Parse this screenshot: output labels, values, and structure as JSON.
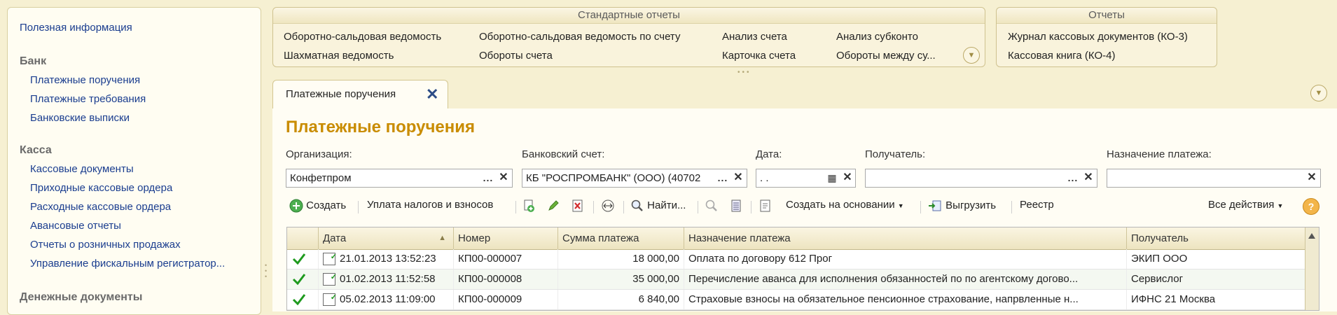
{
  "sidebar": {
    "useful_info": "Полезная информация",
    "groups": [
      {
        "title": "Банк",
        "items": [
          "Платежные поручения",
          "Платежные требования",
          "Банковские выписки"
        ]
      },
      {
        "title": "Касса",
        "items": [
          "Кассовые документы",
          "Приходные кассовые ордера",
          "Расходные кассовые ордера",
          "Авансовые отчеты",
          "Отчеты о розничных продажах",
          "Управление фискальным регистратор..."
        ]
      },
      {
        "title": "Денежные документы",
        "items": []
      }
    ]
  },
  "standard_reports": {
    "title": "Стандартные отчеты",
    "links": [
      "Оборотно-сальдовая ведомость",
      "Оборотно-сальдовая ведомость по счету",
      "Анализ счета",
      "Анализ субконто",
      "Шахматная ведомость",
      "Обороты счета",
      "Карточка счета",
      "Обороты между су..."
    ]
  },
  "reports": {
    "title": "Отчеты",
    "links": [
      "Журнал кассовых документов (КО-3)",
      "Кассовая книга (КО-4)"
    ]
  },
  "tab": {
    "label": "Платежные поручения"
  },
  "page_title": "Платежные поручения",
  "filters": {
    "organization": {
      "label": "Организация:",
      "value": "Конфетпром"
    },
    "bank_account": {
      "label": "Банковский счет:",
      "value": "КБ \"РОСПРОМБАНК\" (ООО) (40702"
    },
    "date": {
      "label": "Дата:",
      "value": " .  ."
    },
    "recipient": {
      "label": "Получатель:",
      "value": ""
    },
    "purpose": {
      "label": "Назначение платежа:",
      "value": ""
    }
  },
  "toolbar": {
    "create": "Создать",
    "taxes": "Уплата налогов и взносов",
    "find": "Найти...",
    "create_based": "Создать на основании",
    "upload": "Выгрузить",
    "registry": "Реестр",
    "all_actions": "Все действия",
    "help": "?"
  },
  "table": {
    "columns": [
      "Дата",
      "Номер",
      "Сумма платежа",
      "Назначение платежа",
      "Получатель"
    ],
    "rows": [
      {
        "date": "21.01.2013 13:52:23",
        "number": "КП00-000007",
        "sum": "18 000,00",
        "purpose": "Оплата по договору 612 Прог",
        "recipient": "ЭКИП ООО"
      },
      {
        "date": "01.02.2013 11:52:58",
        "number": "КП00-000008",
        "sum": "35 000,00",
        "purpose": "Перечисление аванса для исполнения обязанностей по по агентскому догово...",
        "recipient": "Сервислог"
      },
      {
        "date": "05.02.2013 11:09:00",
        "number": "КП00-000009",
        "sum": "6 840,00",
        "purpose": "Страховые взносы на обязательное пенсионное страхование, напрвленные н...",
        "recipient": "ИФНС 21 Москва"
      }
    ]
  },
  "colors": {
    "accent": "#c98c00",
    "link": "#1a3d8f",
    "check": "#1e9a1e",
    "background": "#f6f0d2"
  }
}
